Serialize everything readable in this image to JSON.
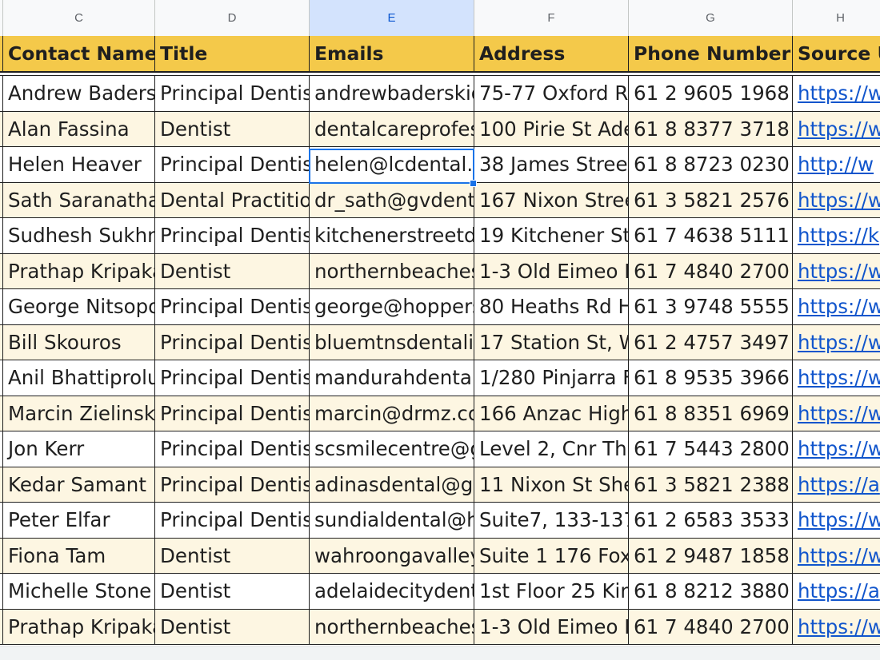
{
  "column_letters": [
    "C",
    "D",
    "E",
    "F",
    "G",
    "H"
  ],
  "selected_column": "E",
  "headers": [
    "Contact Name",
    "Title",
    "Emails",
    "Address",
    "Phone Number",
    "Source U"
  ],
  "rows": [
    [
      "Andrew Baders",
      "Principal Dentis",
      "andrewbaderskid",
      "75-77 Oxford Ro",
      "61 2 9605 1968",
      "https://w"
    ],
    [
      "Alan Fassina",
      "Dentist",
      "dentalcareprofes",
      "100 Pirie St Ade",
      "61 8 8377 3718",
      "https://w"
    ],
    [
      "Helen Heaver",
      "Principal Dentis",
      "helen@lcdental.",
      "38 James Street",
      "61 8 8723 0230",
      "http://w"
    ],
    [
      "Sath Saranatha",
      "Dental Practitio",
      "dr_sath@gvdent",
      "167 Nixon Stree",
      "61 3 5821 2576",
      "https://w"
    ],
    [
      "Sudhesh Sukhn",
      "Principal Dentis",
      "kitchenerstreetd",
      "19 Kitchener St",
      "61 7 4638 5111",
      "https://k"
    ],
    [
      "Prathap Kripaka",
      "Dentist",
      "northernbeaches",
      "1-3 Old Eimeo F",
      "61 7 4840 2700",
      "https://w"
    ],
    [
      "George Nitsopo",
      "Principal Dentis",
      "george@hoppers",
      "80 Heaths Rd H",
      "61 3 9748 5555",
      "https://w"
    ],
    [
      "Bill Skouros",
      "Principal Dentis",
      "bluemtnsdentali",
      "17 Station St, W",
      "61 2 4757 3497",
      "https://w"
    ],
    [
      "Anil Bhattiprolu",
      "Principal Dentis",
      "mandurahdental",
      "1/280 Pinjarra F",
      "61 8 9535 3966",
      "https://w"
    ],
    [
      "Marcin Zielinsk",
      "Principal Dentis",
      "marcin@drmz.co",
      "166 Anzac High",
      "61 8 8351 6969",
      "https://w"
    ],
    [
      "Jon Kerr",
      "Principal Dentis",
      "scsmilecentre@g",
      "Level 2, Cnr The",
      "61 7 5443 2800",
      "https://w"
    ],
    [
      "Kedar Samant",
      "Principal Dentis",
      "adinasdental@gr",
      "11 Nixon St She",
      "61 3 5821 2388",
      "https://a"
    ],
    [
      "Peter Elfar",
      "Principal Dentis",
      "sundialdental@h",
      "Suite7, 133-137",
      "61 2 6583 3533",
      "https://w"
    ],
    [
      "Fiona Tam",
      "Dentist",
      "wahroongavalley",
      "Suite 1 176 Fox",
      "61 2 9487 1858",
      "https://w"
    ],
    [
      "Michelle Stone",
      "Dentist",
      "adelaidecitydent",
      "1st Floor 25 Kin",
      "61 8 8212 3880",
      "https://a"
    ],
    [
      "Prathap Kripaka",
      "Dentist",
      "northernbeaches",
      "1-3 Old Eimeo F",
      "61 7 4840 2700",
      "https://w"
    ]
  ],
  "colors": {
    "header_fill": "#f4c94a",
    "alt_row_fill": "#fdf6e2",
    "link": "#1155cc",
    "selection": "#1a73e8"
  }
}
